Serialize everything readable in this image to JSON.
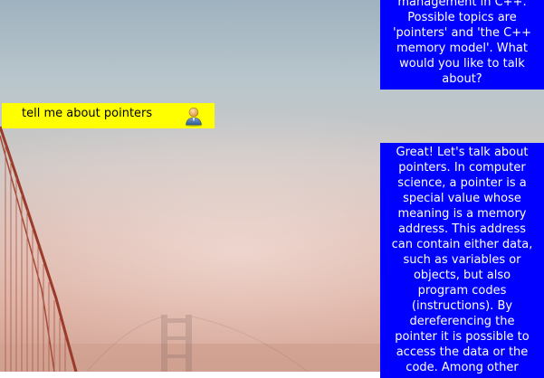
{
  "chat": {
    "messages": [
      {
        "role": "bot",
        "text": "management in C++. Possible topics are 'pointers' and 'the C++ memory model'. What would you like to talk about?"
      },
      {
        "role": "user",
        "text": "tell me about pointers",
        "avatar_icon": "user-avatar-icon"
      },
      {
        "role": "bot",
        "text": "Great! Let's talk about pointers. In computer science, a pointer is a special value whose meaning is a memory address. This address can contain either data, such as variables or objects, but also program codes (instructions). By dereferencing the pointer it is possible to access the data or the code. Among other"
      }
    ]
  },
  "colors": {
    "bot_bubble": "#0000ff",
    "bot_text": "#ffffff",
    "user_bubble": "#ffff00",
    "user_text": "#000000"
  }
}
